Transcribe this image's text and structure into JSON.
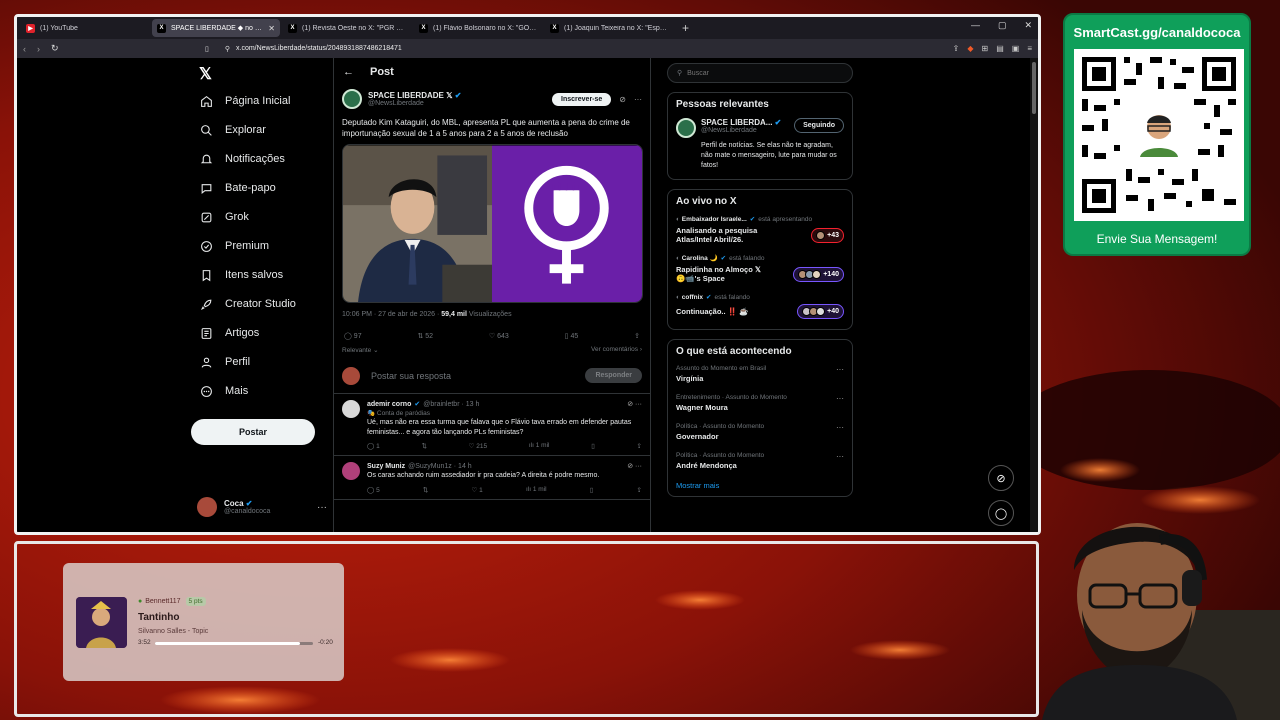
{
  "browser": {
    "tabs": [
      {
        "title": "(1) YouTube",
        "active": false,
        "favicon_color": "#e0222b"
      },
      {
        "title": "SPACE LIBERDADE ◆ no X: \"Deputado",
        "active": true,
        "favicon_color": "#000000"
      },
      {
        "title": "(1) Revista Oeste no X: \"PGR arquiva",
        "active": false,
        "favicon_color": "#000000"
      },
      {
        "title": "(1) Flávio Bolsonaro no X: \"GOVERNO",
        "active": false,
        "favicon_color": "#000000"
      },
      {
        "title": "(1) Joaquin Teixeira no X: \"Espero qu",
        "active": false,
        "favicon_color": "#000000"
      }
    ],
    "url": "x.com/NewsLiberdade/status/2048931887486218471"
  },
  "nav": {
    "items": [
      {
        "label": "Página Inicial",
        "icon": "home-icon"
      },
      {
        "label": "Explorar",
        "icon": "search-icon"
      },
      {
        "label": "Notificações",
        "icon": "bell-icon"
      },
      {
        "label": "Bate-papo",
        "icon": "chat-icon"
      },
      {
        "label": "Grok",
        "icon": "grok-icon"
      },
      {
        "label": "Premium",
        "icon": "premium-icon"
      },
      {
        "label": "Itens salvos",
        "icon": "bookmark-icon"
      },
      {
        "label": "Creator Studio",
        "icon": "rocket-icon"
      },
      {
        "label": "Artigos",
        "icon": "article-icon"
      },
      {
        "label": "Perfil",
        "icon": "person-icon"
      },
      {
        "label": "Mais",
        "icon": "more-icon"
      }
    ],
    "post_button": "Postar",
    "account": {
      "name": "Coca",
      "handle": "@canaldococa"
    }
  },
  "post": {
    "header": "Post",
    "author_name": "SPACE LIBERDADE",
    "author_handle": "@NewsLiberdade",
    "subscribe_label": "Inscrever-se",
    "text": "Deputado Kim Kataguiri, do MBL, apresenta PL que aumenta a pena do crime de importunação sexual de 1 a 5 anos para 2 a 5 anos de reclusão",
    "time": "10:06 PM · 27 de abr de 2026 ·",
    "views": "59,4 mil",
    "views_label": "Visualizações",
    "replies": "97",
    "reposts": "52",
    "likes": "643",
    "bookmarks": "45",
    "sort_label": "Relevante",
    "view_comments": "Ver comentários"
  },
  "reply_box": {
    "placeholder": "Postar sua resposta",
    "button": "Responder"
  },
  "replies": [
    {
      "name": "ademir corno",
      "handle": "@brainletbr",
      "time": "13 h",
      "tag": "Conta de paródias",
      "text": "Ué, mas não era essa turma que falava que o Flávio tava errado em defender pautas feministas... e agora tão lançando PLs feministas?",
      "replies": "1",
      "reposts": "",
      "likes": "215",
      "views": "1 mil"
    },
    {
      "name": "Suzy Muniz",
      "handle": "@SuzyMun1z",
      "time": "14 h",
      "tag": "",
      "text": "Os caras achando ruim assediador ir pra cadeia? A direita é podre mesmo.",
      "replies": "5",
      "reposts": "",
      "likes": "1",
      "views": "1 mil"
    }
  ],
  "sidebar": {
    "search_placeholder": "Buscar",
    "relevant": {
      "title": "Pessoas relevantes",
      "name": "SPACE LIBERDA...",
      "handle": "@NewsLiberdade",
      "follow_label": "Seguindo",
      "bio": "Perfil de notícias. Se elas não te agradam, não mate o mensageiro, lute para mudar os fatos!"
    },
    "live": {
      "title": "Ao vivo no X",
      "items": [
        {
          "host": "Embaixador Israele...",
          "status": "está apresentando",
          "title": "Analisando a pesquisa Atlas/Intel Abril/26.",
          "count": "+43",
          "style": "red"
        },
        {
          "host": "Carolina 🌙",
          "status": "está falando",
          "title": "Rapidinha no Almoço 𝕏 🙃📹's Space",
          "count": "+140",
          "style": "purple"
        },
        {
          "host": "coffnix",
          "status": "está falando",
          "title": "Continuação.. ‼️ ☕",
          "count": "+40",
          "style": "purple"
        }
      ]
    },
    "trends": {
      "title": "O que está acontecendo",
      "items": [
        {
          "context": "Assunto do Momento em Brasil",
          "name": "Virgínia"
        },
        {
          "context": "Entretenimento · Assunto do Momento",
          "name": "Wagner Moura"
        },
        {
          "context": "Política · Assunto do Momento",
          "name": "Governador"
        },
        {
          "context": "Política · Assunto do Momento",
          "name": "André Mendonça"
        }
      ],
      "show_more": "Mostrar mais"
    }
  },
  "overlay": {
    "qr_link": "SmartCast.gg/canaldococa",
    "qr_message": "Envie Sua Mensagem!",
    "player": {
      "user": "Bennett117",
      "points": "5 pts",
      "title": "Tantinho",
      "artist": "Silvanno Salles - Topic",
      "elapsed": "3:52",
      "remaining": "-0:20",
      "progress": 0.92
    }
  },
  "colors": {
    "accent": "#1d9bf0",
    "x_background": "#000000",
    "qr_card": "#0f9f5a",
    "overlay_background": "#8a1208"
  }
}
